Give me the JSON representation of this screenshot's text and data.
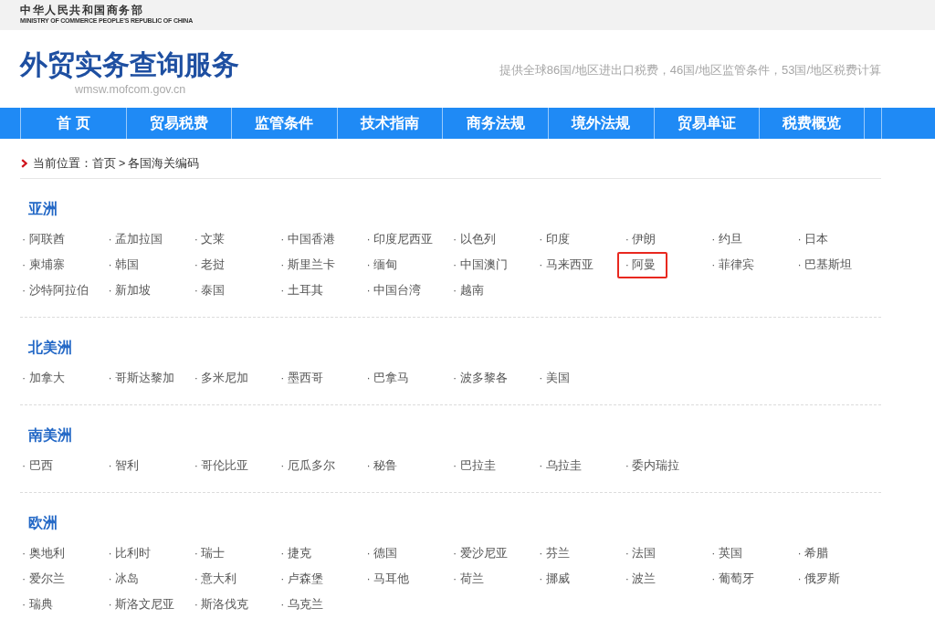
{
  "top_bar": {
    "logo_title": "中华人民共和国商务部",
    "logo_subtitle": "MINISTRY OF COMMERCE PEOPLE'S REPUBLIC OF CHINA"
  },
  "header": {
    "title": "外贸实务查询服务",
    "domain": "wmsw.mofcom.gov.cn",
    "tagline": "提供全球86国/地区进出口税费，46国/地区监管条件，53国/地区税费计算"
  },
  "nav": [
    {
      "label": "首 页"
    },
    {
      "label": "贸易税费"
    },
    {
      "label": "监管条件"
    },
    {
      "label": "技术指南"
    },
    {
      "label": "商务法规"
    },
    {
      "label": "境外法规"
    },
    {
      "label": "贸易单证"
    },
    {
      "label": "税费概览"
    }
  ],
  "breadcrumb": {
    "label": "当前位置：",
    "separator": ">",
    "items": [
      {
        "text": "首页"
      },
      {
        "text": "各国海关编码"
      }
    ]
  },
  "regions": [
    {
      "title": "亚洲",
      "countries": [
        {
          "label": "· 阿联酋",
          "selected": false
        },
        {
          "label": "· 孟加拉国",
          "selected": false
        },
        {
          "label": "· 文莱",
          "selected": false
        },
        {
          "label": "· 中国香港",
          "selected": false
        },
        {
          "label": "· 印度尼西亚",
          "selected": false
        },
        {
          "label": "· 以色列",
          "selected": false
        },
        {
          "label": "· 印度",
          "selected": false
        },
        {
          "label": "· 伊朗",
          "selected": false
        },
        {
          "label": "· 约旦",
          "selected": false
        },
        {
          "label": "· 日本",
          "selected": false
        },
        {
          "label": "· 柬埔寨",
          "selected": false
        },
        {
          "label": "· 韩国",
          "selected": false
        },
        {
          "label": "· 老挝",
          "selected": false
        },
        {
          "label": "· 斯里兰卡",
          "selected": false
        },
        {
          "label": "· 缅甸",
          "selected": false
        },
        {
          "label": "· 中国澳门",
          "selected": false
        },
        {
          "label": "· 马来西亚",
          "selected": false
        },
        {
          "label": "· 阿曼",
          "selected": true
        },
        {
          "label": "· 菲律宾",
          "selected": false
        },
        {
          "label": "· 巴基斯坦",
          "selected": false
        },
        {
          "label": "· 沙特阿拉伯",
          "selected": false
        },
        {
          "label": "· 新加坡",
          "selected": false
        },
        {
          "label": "· 泰国",
          "selected": false
        },
        {
          "label": "· 土耳其",
          "selected": false
        },
        {
          "label": "· 中国台湾",
          "selected": false
        },
        {
          "label": "· 越南",
          "selected": false
        }
      ]
    },
    {
      "title": "北美洲",
      "countries": [
        {
          "label": "· 加拿大",
          "selected": false
        },
        {
          "label": "· 哥斯达黎加",
          "selected": false
        },
        {
          "label": "· 多米尼加",
          "selected": false
        },
        {
          "label": "· 墨西哥",
          "selected": false
        },
        {
          "label": "· 巴拿马",
          "selected": false
        },
        {
          "label": "· 波多黎各",
          "selected": false
        },
        {
          "label": "· 美国",
          "selected": false
        }
      ]
    },
    {
      "title": "南美洲",
      "countries": [
        {
          "label": "· 巴西",
          "selected": false
        },
        {
          "label": "· 智利",
          "selected": false
        },
        {
          "label": "· 哥伦比亚",
          "selected": false
        },
        {
          "label": "· 厄瓜多尔",
          "selected": false
        },
        {
          "label": "· 秘鲁",
          "selected": false
        },
        {
          "label": "· 巴拉圭",
          "selected": false
        },
        {
          "label": "· 乌拉圭",
          "selected": false
        },
        {
          "label": "· 委内瑞拉",
          "selected": false
        }
      ]
    },
    {
      "title": "欧洲",
      "countries": [
        {
          "label": "· 奥地利",
          "selected": false
        },
        {
          "label": "· 比利时",
          "selected": false
        },
        {
          "label": "· 瑞士",
          "selected": false
        },
        {
          "label": "· 捷克",
          "selected": false
        },
        {
          "label": "· 德国",
          "selected": false
        },
        {
          "label": "· 爱沙尼亚",
          "selected": false
        },
        {
          "label": "· 芬兰",
          "selected": false
        },
        {
          "label": "· 法国",
          "selected": false
        },
        {
          "label": "· 英国",
          "selected": false
        },
        {
          "label": "· 希腊",
          "selected": false
        },
        {
          "label": "· 爱尔兰",
          "selected": false
        },
        {
          "label": "· 冰岛",
          "selected": false
        },
        {
          "label": "· 意大利",
          "selected": false
        },
        {
          "label": "· 卢森堡",
          "selected": false
        },
        {
          "label": "· 马耳他",
          "selected": false
        },
        {
          "label": "· 荷兰",
          "selected": false
        },
        {
          "label": "· 挪威",
          "selected": false
        },
        {
          "label": "· 波兰",
          "selected": false
        },
        {
          "label": "· 葡萄牙",
          "selected": false
        },
        {
          "label": "· 俄罗斯",
          "selected": false
        },
        {
          "label": "· 瑞典",
          "selected": false
        },
        {
          "label": "· 斯洛文尼亚",
          "selected": false
        },
        {
          "label": "· 斯洛伐克",
          "selected": false
        },
        {
          "label": "· 乌克兰",
          "selected": false
        }
      ]
    }
  ]
}
